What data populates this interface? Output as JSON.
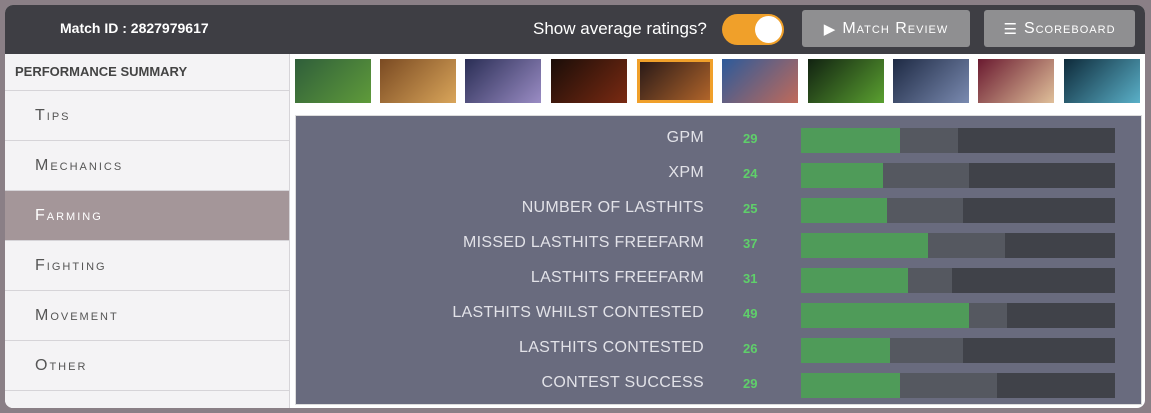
{
  "header": {
    "match_id": "Match ID : 2827979617",
    "avg_label": "Show average ratings?",
    "avg_enabled": true,
    "review_label": "Match Review",
    "scoreboard_label": "Scoreboard",
    "accent": "#f0a02a"
  },
  "sidebar": {
    "title": "PERFORMANCE SUMMARY",
    "items": [
      {
        "label": "Tips",
        "active": false
      },
      {
        "label": "Mechanics",
        "active": false
      },
      {
        "label": "Farming",
        "active": true
      },
      {
        "label": "Fighting",
        "active": false
      },
      {
        "label": "Movement",
        "active": false
      },
      {
        "label": "Other",
        "active": false
      }
    ]
  },
  "heroes": {
    "selected_index": 4,
    "items": [
      {
        "name": "hero-portrait-1",
        "colors": [
          "#2f5e3a",
          "#5f9b3a"
        ]
      },
      {
        "name": "hero-portrait-2",
        "colors": [
          "#7a4a22",
          "#d9a55a"
        ]
      },
      {
        "name": "hero-portrait-3",
        "colors": [
          "#2a2e55",
          "#9a8cc4"
        ]
      },
      {
        "name": "hero-portrait-4",
        "colors": [
          "#1a0d08",
          "#7a2a12"
        ]
      },
      {
        "name": "hero-portrait-5",
        "colors": [
          "#2a1a18",
          "#b0642a"
        ]
      },
      {
        "name": "hero-portrait-6",
        "colors": [
          "#2c5a9a",
          "#c06a5a"
        ]
      },
      {
        "name": "hero-portrait-7",
        "colors": [
          "#112211",
          "#5aa030"
        ]
      },
      {
        "name": "hero-portrait-8",
        "colors": [
          "#1e2a44",
          "#7a8ab0"
        ]
      },
      {
        "name": "hero-portrait-9",
        "colors": [
          "#6a1a30",
          "#e0c09a"
        ]
      },
      {
        "name": "hero-portrait-10",
        "colors": [
          "#0e2a3a",
          "#5ab0c8"
        ]
      }
    ]
  },
  "metrics": [
    {
      "label": "GPM",
      "value": "29",
      "score": 0.315,
      "average": 0.5
    },
    {
      "label": "XPM",
      "value": "24",
      "score": 0.26,
      "average": 0.535
    },
    {
      "label": "NUMBER OF LASTHITS",
      "value": "25",
      "score": 0.275,
      "average": 0.515
    },
    {
      "label": "MISSED LASTHITS FREEFARM",
      "value": "37",
      "score": 0.405,
      "average": 0.65
    },
    {
      "label": "LASTHITS FREEFARM",
      "value": "31",
      "score": 0.34,
      "average": 0.48
    },
    {
      "label": "LASTHITS WHILST CONTESTED",
      "value": "49",
      "score": 0.535,
      "average": 0.655
    },
    {
      "label": "LASTHITS CONTESTED",
      "value": "26",
      "score": 0.285,
      "average": 0.515
    },
    {
      "label": "CONTEST SUCCESS",
      "value": "29",
      "score": 0.315,
      "average": 0.625
    }
  ]
}
